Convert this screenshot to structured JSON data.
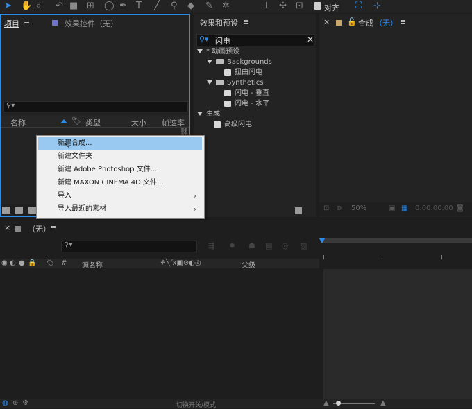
{
  "toolbar": {
    "align_label": "对齐"
  },
  "project_panel": {
    "tab": "项目",
    "effect_controls_tab": "效果控件（无）",
    "columns": {
      "name": "名称",
      "type": "类型",
      "size": "大小",
      "framerate": "帧速率"
    }
  },
  "effects_panel": {
    "tab": "效果和预设",
    "search_value": "闪电",
    "tree": [
      {
        "label": "* 动画预设",
        "kind": "category"
      },
      {
        "label": "Backgrounds",
        "kind": "folder"
      },
      {
        "label": "扭曲闪电",
        "kind": "preset"
      },
      {
        "label": "Synthetics",
        "kind": "folder"
      },
      {
        "label": "闪电 - 垂直",
        "kind": "preset"
      },
      {
        "label": "闪电 - 水平",
        "kind": "preset"
      },
      {
        "label": "生成",
        "kind": "category"
      },
      {
        "label": "高级闪电",
        "kind": "preset"
      }
    ]
  },
  "composition_panel": {
    "tab": "合成",
    "tab_state": "（无）",
    "zoom": "50%",
    "timecode": "0:00:00:00"
  },
  "context_menu": {
    "items": [
      {
        "label": "新建合成...",
        "submenu": false,
        "highlighted": true
      },
      {
        "label": "新建文件夹",
        "submenu": false,
        "highlighted": false
      },
      {
        "label": "新建 Adobe Photoshop 文件...",
        "submenu": false,
        "highlighted": false
      },
      {
        "label": "新建 MAXON CINEMA 4D 文件...",
        "submenu": false,
        "highlighted": false
      },
      {
        "label": "导入",
        "submenu": true,
        "highlighted": false
      },
      {
        "label": "导入最近的素材",
        "submenu": true,
        "highlighted": false
      }
    ],
    "submenu_arrow": "›"
  },
  "timeline": {
    "tab": "（无）",
    "columns": {
      "hash": "#",
      "source_name": "源名称",
      "parent": "父级"
    },
    "footer_label": "切换开关/模式"
  },
  "colors": {
    "accent": "#2d8ceb",
    "menu_highlight": "#99c9f0",
    "comp_swatch": "#c9a86a",
    "effects_swatch": "#6d74c4"
  },
  "icons": {
    "selection": "selection-tool-icon",
    "hand": "hand-tool-icon",
    "zoom": "zoom-tool-icon",
    "search": "search-icon"
  }
}
